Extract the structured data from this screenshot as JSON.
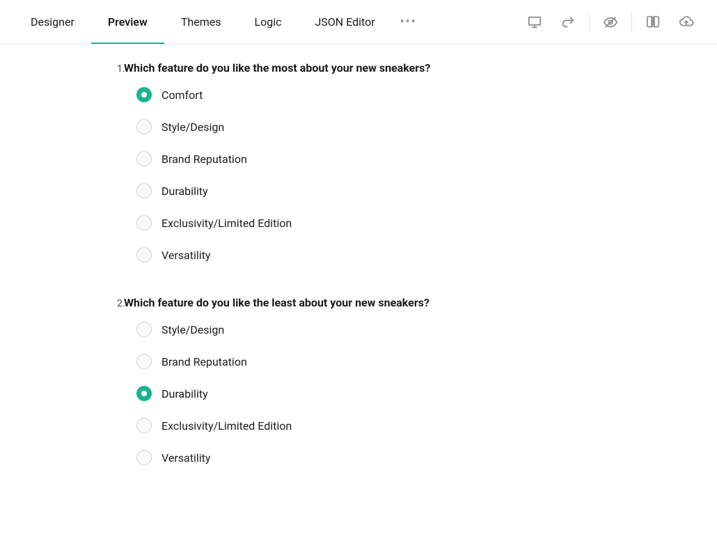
{
  "tabs": {
    "designer": "Designer",
    "preview": "Preview",
    "themes": "Themes",
    "logic": "Logic",
    "json_editor": "JSON Editor"
  },
  "active_tab": "preview",
  "questions": [
    {
      "number": "1.",
      "title": "Which  feature do you like the most about your new sneakers?",
      "selected_index": 0,
      "choices": [
        "Comfort",
        "Style/Design",
        "Brand Reputation",
        "Durability",
        "Exclusivity/Limited Edition",
        "Versatility"
      ]
    },
    {
      "number": "2.",
      "title": "Which feature do you like the least about your new sneakers?",
      "selected_index": 2,
      "choices": [
        "Style/Design",
        "Brand Reputation",
        "Durability",
        "Exclusivity/Limited Edition",
        "Versatility"
      ]
    }
  ]
}
